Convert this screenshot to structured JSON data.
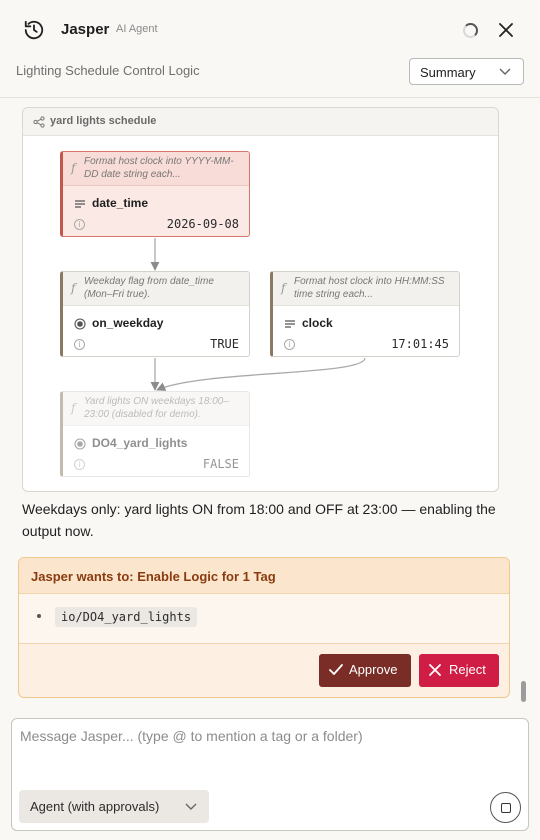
{
  "header": {
    "agent_name": "Jasper",
    "agent_role": "AI Agent",
    "subtitle": "Lighting Schedule Control Logic",
    "view_select": "Summary"
  },
  "graph": {
    "title": "yard lights schedule",
    "nodes": [
      {
        "id": "date_time",
        "description": "Format host clock into YYYY-MM-DD date string each...",
        "name": "date_time",
        "value": "2026-09-08",
        "kind": "text",
        "state": "selected"
      },
      {
        "id": "on_weekday",
        "description": "Weekday flag from date_time (Mon–Fri true).",
        "name": "on_weekday",
        "value": "TRUE",
        "kind": "boolean",
        "state": "normal"
      },
      {
        "id": "clock",
        "description": "Format host clock into HH:MM:SS time string each...",
        "name": "clock",
        "value": "17:01:45",
        "kind": "text",
        "state": "normal"
      },
      {
        "id": "DO4_yard_lights",
        "description": "Yard lights ON weekdays 18:00–23:00 (disabled for demo).",
        "name": "DO4_yard_lights",
        "value": "FALSE",
        "kind": "boolean",
        "state": "disabled"
      }
    ]
  },
  "message": "Weekdays only: yard lights ON from 18:00 and OFF at 23:00 — enabling the output now.",
  "approval": {
    "title": "Jasper wants to: Enable Logic for 1 Tag",
    "tags": [
      "io/DO4_yard_lights"
    ],
    "approve_label": "Approve",
    "reject_label": "Reject"
  },
  "composer": {
    "placeholder": "Message Jasper... (type @ to mention a tag or a folder)",
    "mode": "Agent (with approvals)"
  }
}
